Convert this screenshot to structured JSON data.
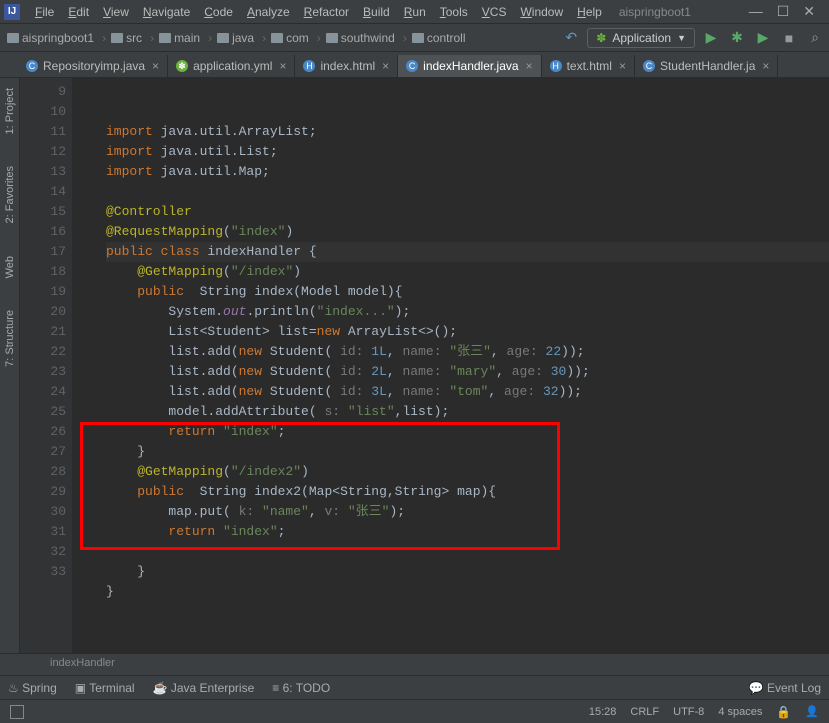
{
  "menu": {
    "items": [
      "File",
      "Edit",
      "View",
      "Navigate",
      "Code",
      "Analyze",
      "Refactor",
      "Build",
      "Run",
      "Tools",
      "VCS",
      "Window",
      "Help"
    ],
    "title": "aispringboot1"
  },
  "breadcrumbs": [
    "aispringboot1",
    "src",
    "main",
    "java",
    "com",
    "southwind",
    "controll"
  ],
  "run_config": "Application",
  "tabs": [
    {
      "label": "Repositoryimp.java",
      "icon": "java",
      "active": false
    },
    {
      "label": "application.yml",
      "icon": "spring",
      "active": false
    },
    {
      "label": "index.html",
      "icon": "html",
      "active": false
    },
    {
      "label": "indexHandler.java",
      "icon": "java",
      "active": true
    },
    {
      "label": "text.html",
      "icon": "html",
      "active": false
    },
    {
      "label": "StudentHandler.ja",
      "icon": "java",
      "active": false
    }
  ],
  "side_tabs": [
    "1: Project",
    "2: Favorites",
    "Web",
    "7: Structure"
  ],
  "gutter": {
    "start": 9,
    "end": 33
  },
  "code": [
    {
      "n": 9,
      "segs": [
        [
          "kw",
          "import "
        ],
        [
          "",
          "java.util.ArrayList;"
        ]
      ]
    },
    {
      "n": 10,
      "segs": [
        [
          "kw",
          "import "
        ],
        [
          "",
          "java.util.List;"
        ]
      ]
    },
    {
      "n": 11,
      "segs": [
        [
          "kw",
          "import "
        ],
        [
          "",
          "java.util.Map;"
        ]
      ]
    },
    {
      "n": 12,
      "segs": [
        [
          "",
          ""
        ]
      ]
    },
    {
      "n": 13,
      "segs": [
        [
          "ann",
          "@Controller"
        ]
      ]
    },
    {
      "n": 14,
      "segs": [
        [
          "ann",
          "@RequestMapping"
        ],
        [
          "",
          "("
        ],
        [
          "str",
          "\"index\""
        ],
        [
          "",
          ")"
        ]
      ]
    },
    {
      "n": 15,
      "segs": [
        [
          "kw",
          "public class "
        ],
        [
          "",
          "indexHandler "
        ],
        [
          "",
          "{"
        ]
      ],
      "hl": true
    },
    {
      "n": 16,
      "segs": [
        [
          "",
          "    "
        ],
        [
          "ann",
          "@GetMapping"
        ],
        [
          "",
          "("
        ],
        [
          "str",
          "\"/index\""
        ],
        [
          "",
          ")"
        ]
      ]
    },
    {
      "n": 17,
      "segs": [
        [
          "",
          "    "
        ],
        [
          "kw",
          "public  "
        ],
        [
          "",
          "String index(Model model){"
        ]
      ]
    },
    {
      "n": 18,
      "segs": [
        [
          "",
          "        System."
        ],
        [
          "static",
          "out"
        ],
        [
          "",
          ".println("
        ],
        [
          "str",
          "\"index...\""
        ],
        [
          "",
          ");"
        ]
      ]
    },
    {
      "n": 19,
      "segs": [
        [
          "",
          "        List<Student> list="
        ],
        [
          "kw",
          "new "
        ],
        [
          "",
          "ArrayList<>();"
        ]
      ]
    },
    {
      "n": 20,
      "segs": [
        [
          "",
          "        list.add("
        ],
        [
          "kw",
          "new "
        ],
        [
          "",
          "Student( "
        ],
        [
          "hint",
          "id: "
        ],
        [
          "num",
          "1L"
        ],
        [
          "",
          ", "
        ],
        [
          "hint",
          "name: "
        ],
        [
          "str",
          "\"张三\""
        ],
        [
          "",
          ", "
        ],
        [
          "hint",
          "age: "
        ],
        [
          "num",
          "22"
        ],
        [
          "",
          "));"
        ]
      ]
    },
    {
      "n": 21,
      "segs": [
        [
          "",
          "        list.add("
        ],
        [
          "kw",
          "new "
        ],
        [
          "",
          "Student( "
        ],
        [
          "hint",
          "id: "
        ],
        [
          "num",
          "2L"
        ],
        [
          "",
          ", "
        ],
        [
          "hint",
          "name: "
        ],
        [
          "str",
          "\"mary\""
        ],
        [
          "",
          ", "
        ],
        [
          "hint",
          "age: "
        ],
        [
          "num",
          "30"
        ],
        [
          "",
          "));"
        ]
      ]
    },
    {
      "n": 22,
      "segs": [
        [
          "",
          "        list.add("
        ],
        [
          "kw",
          "new "
        ],
        [
          "",
          "Student( "
        ],
        [
          "hint",
          "id: "
        ],
        [
          "num",
          "3L"
        ],
        [
          "",
          ", "
        ],
        [
          "hint",
          "name: "
        ],
        [
          "str",
          "\"tom\""
        ],
        [
          "",
          ", "
        ],
        [
          "hint",
          "age: "
        ],
        [
          "num",
          "32"
        ],
        [
          "",
          "));"
        ]
      ]
    },
    {
      "n": 23,
      "segs": [
        [
          "",
          "        model.addAttribute( "
        ],
        [
          "hint",
          "s: "
        ],
        [
          "str",
          "\"list\""
        ],
        [
          "",
          ",list);"
        ]
      ]
    },
    {
      "n": 24,
      "segs": [
        [
          "",
          "        "
        ],
        [
          "kw",
          "return "
        ],
        [
          "str",
          "\"index\""
        ],
        [
          "",
          ";"
        ]
      ]
    },
    {
      "n": 25,
      "segs": [
        [
          "",
          "    }"
        ]
      ]
    },
    {
      "n": 26,
      "segs": [
        [
          "",
          "    "
        ],
        [
          "ann",
          "@GetMapping"
        ],
        [
          "",
          "("
        ],
        [
          "str",
          "\"/index2\""
        ],
        [
          "",
          ")"
        ]
      ]
    },
    {
      "n": 27,
      "segs": [
        [
          "",
          "    "
        ],
        [
          "kw",
          "public  "
        ],
        [
          "",
          "String "
        ],
        [
          "",
          "index2"
        ],
        [
          "",
          "(Map<String,String> map){"
        ]
      ]
    },
    {
      "n": 28,
      "segs": [
        [
          "",
          "        map.put( "
        ],
        [
          "hint",
          "k: "
        ],
        [
          "str",
          "\"name\""
        ],
        [
          "",
          ", "
        ],
        [
          "hint",
          "v: "
        ],
        [
          "str",
          "\"张三\""
        ],
        [
          "",
          ");"
        ]
      ]
    },
    {
      "n": 29,
      "segs": [
        [
          "",
          "        "
        ],
        [
          "kw",
          "return "
        ],
        [
          "str",
          "\"index\""
        ],
        [
          "",
          ";"
        ]
      ]
    },
    {
      "n": 30,
      "segs": [
        [
          "",
          ""
        ]
      ]
    },
    {
      "n": 31,
      "segs": [
        [
          "",
          "    }"
        ]
      ]
    },
    {
      "n": 32,
      "segs": [
        [
          "",
          "}"
        ]
      ]
    },
    {
      "n": 33,
      "segs": [
        [
          "",
          ""
        ]
      ]
    }
  ],
  "editor_breadcrumb": "indexHandler",
  "bottom_tools": [
    "Spring",
    "Terminal",
    "Java Enterprise",
    "6: TODO"
  ],
  "bottom_right": "Event Log",
  "status": {
    "time": "15:28",
    "linesep": "CRLF",
    "encoding": "UTF-8",
    "indent": "4 spaces"
  }
}
